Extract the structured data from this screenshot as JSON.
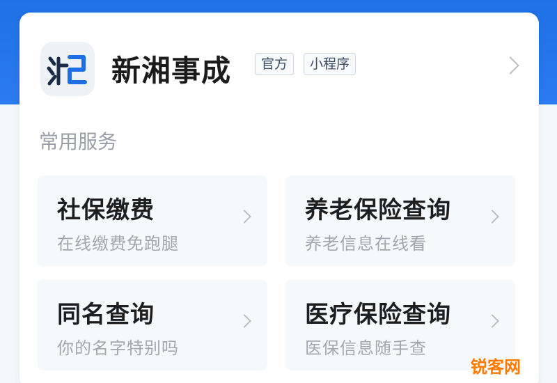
{
  "app": {
    "name": "新湘事成",
    "tag_official": "官方",
    "tag_mini_program": "小程序",
    "logo_text": "湘"
  },
  "section": {
    "title": "常用服务"
  },
  "services": [
    {
      "title": "社保缴费",
      "subtitle": "在线缴费免跑腿"
    },
    {
      "title": "养老保险查询",
      "subtitle": "养老信息在线看"
    },
    {
      "title": "同名查询",
      "subtitle": "你的名字特别吗"
    },
    {
      "title": "医疗保险查询",
      "subtitle": "医保信息随手查"
    }
  ],
  "watermark": "锐客网",
  "colors": {
    "brand_blue": "#1f6fe5",
    "logo_dark": "#1a2b4a",
    "logo_accent": "#1e6ee8",
    "watermark_orange": "#ff7a00"
  }
}
